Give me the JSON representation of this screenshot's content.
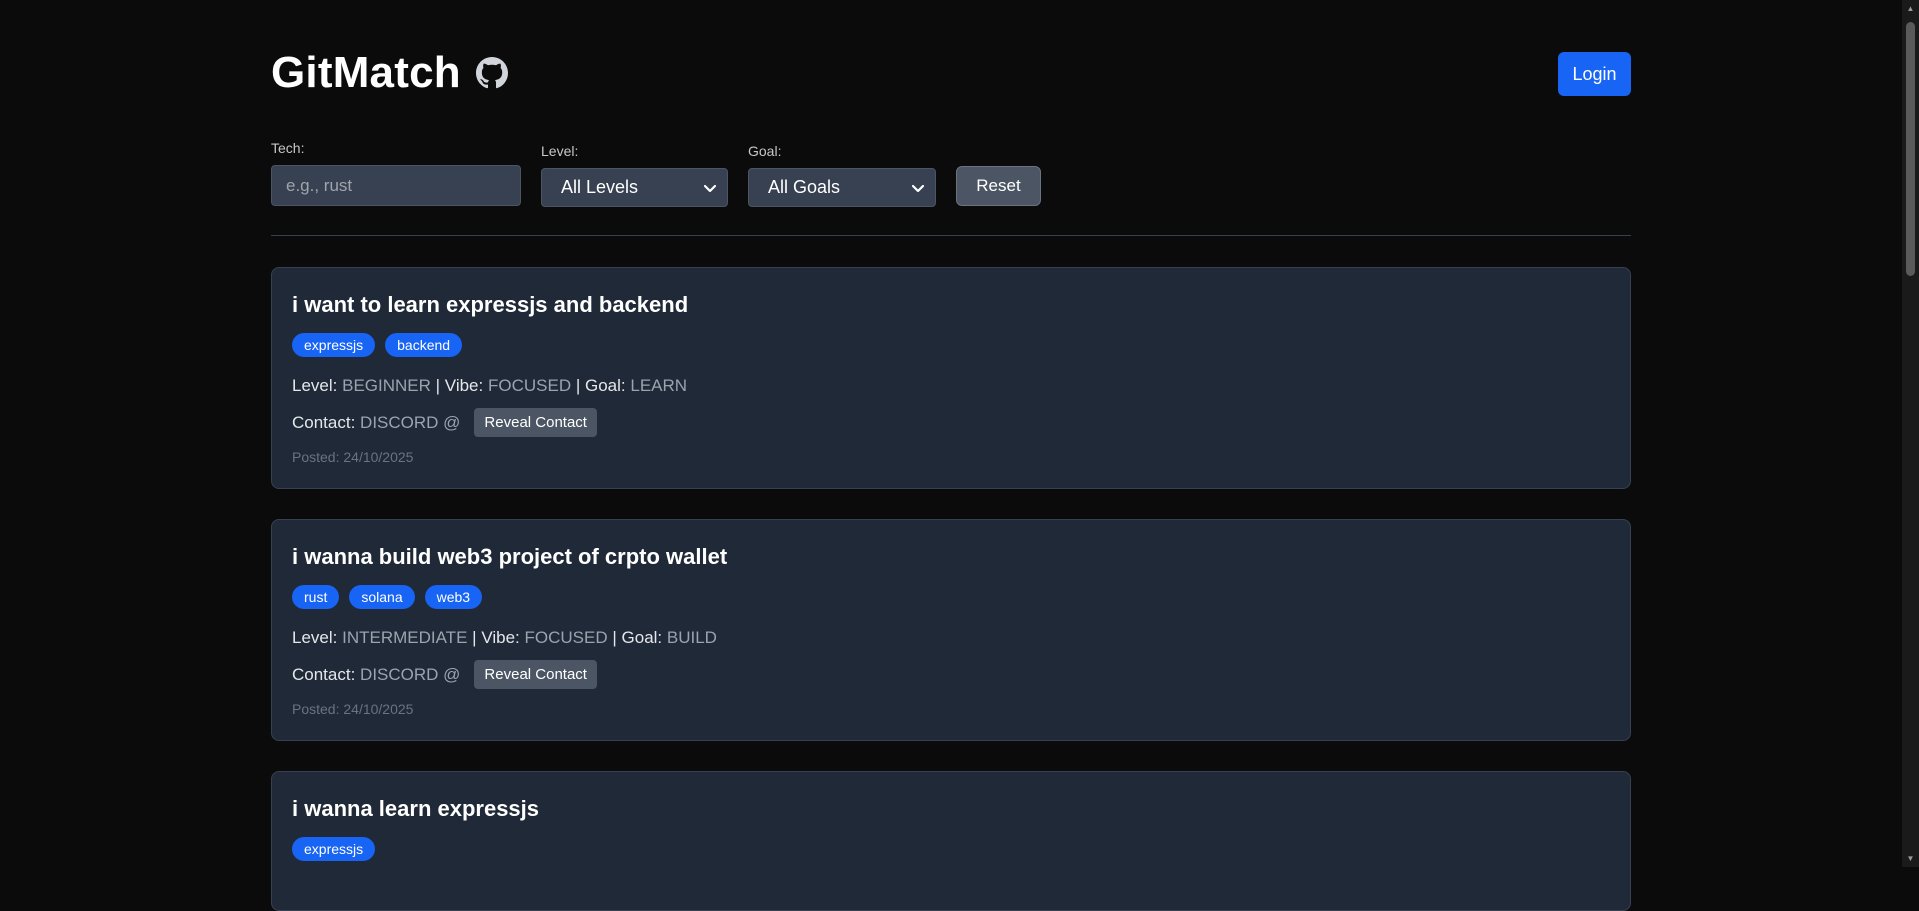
{
  "header": {
    "app_title": "GitMatch",
    "login_label": "Login"
  },
  "filters": {
    "tech_label": "Tech:",
    "tech_placeholder": "e.g., rust",
    "tech_value": "",
    "level_label": "Level:",
    "level_value": "All Levels",
    "goal_label": "Goal:",
    "goal_value": "All Goals",
    "reset_label": "Reset"
  },
  "posts": [
    {
      "title": "i want to learn expressjs and backend",
      "tags": [
        "expressjs",
        "backend"
      ],
      "level": "BEGINNER",
      "vibe": "FOCUSED",
      "goal": "LEARN",
      "contact": "DISCORD @",
      "reveal_label": "Reveal Contact",
      "posted": "Posted: 24/10/2025"
    },
    {
      "title": "i wanna build web3 project of crpto wallet",
      "tags": [
        "rust",
        "solana",
        "web3"
      ],
      "level": "INTERMEDIATE",
      "vibe": "FOCUSED",
      "goal": "BUILD",
      "contact": "DISCORD @",
      "reveal_label": "Reveal Contact",
      "posted": "Posted: 24/10/2025"
    },
    {
      "title": "i wanna learn expressjs",
      "tags": [
        "expressjs"
      ]
    }
  ],
  "labels": {
    "level": "Level:",
    "vibe": "Vibe:",
    "goal": "Goal:",
    "contact": "Contact:",
    "sep": "|"
  },
  "colors": {
    "background": "#0b0b0b",
    "card": "#1f2937",
    "accent": "#1764f5",
    "muted": "#9ca3af"
  },
  "icons": {
    "title_icon": "github-icon",
    "select_icon": "chevron-down-icon"
  }
}
